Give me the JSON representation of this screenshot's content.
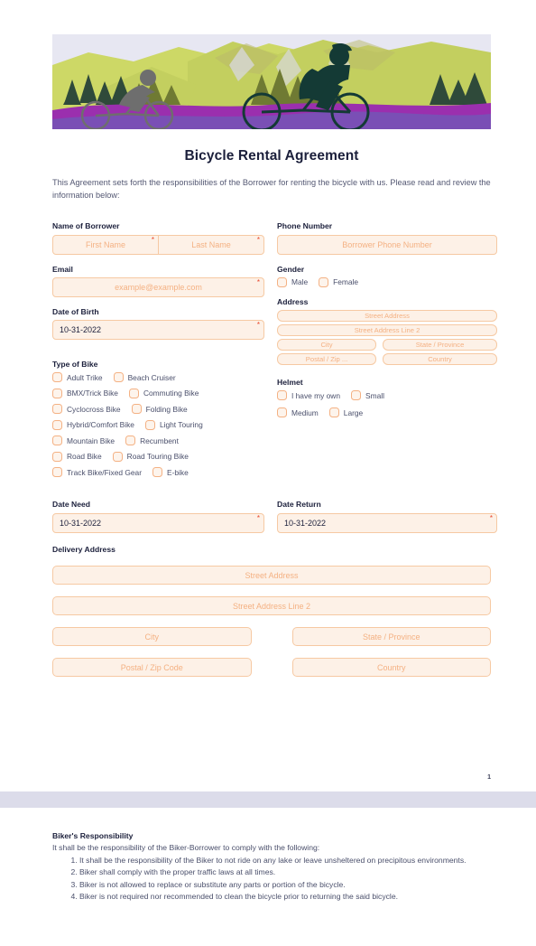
{
  "document": {
    "title": "Bicycle Rental Agreement",
    "intro": "This Agreement sets forth the responsibilities of the Borrower for renting the bicycle with us. Please read and review the information below:",
    "page_number": "1"
  },
  "banner": {
    "alt": "Cyclists riding in mountain landscape",
    "colors": {
      "sky": "#e7e7f2",
      "mountain_light": "#cdd866",
      "mountain_mid": "#c3cf5f",
      "mountain_shadow": "#b9b96a",
      "snow": "#d8d8e0",
      "trees_dark": "#2f4a3a",
      "trees_olive": "#6f7a33",
      "ground_purple": "#9b2fae",
      "ground_violet": "#7a4fb5",
      "rider_grey": "#6e6e6e",
      "rider_teal": "#143a35"
    }
  },
  "form": {
    "name": {
      "label": "Name of Borrower",
      "first_placeholder": "First Name",
      "last_placeholder": "Last Name",
      "required_mark": "*"
    },
    "email": {
      "label": "Email",
      "placeholder": "example@example.com"
    },
    "dob": {
      "label": "Date of Birth",
      "value": "10-31-2022"
    },
    "phone": {
      "label": "Phone Number",
      "placeholder": "Borrower Phone Number"
    },
    "gender": {
      "label": "Gender",
      "options": [
        "Male",
        "Female"
      ]
    },
    "address": {
      "label": "Address",
      "street": "Street Address",
      "street2": "Street Address Line 2",
      "city": "City",
      "state": "State / Province",
      "postal": "Postal / Zip ...",
      "country": "Country"
    },
    "helmet": {
      "label": "Helmet",
      "options": [
        "I have my own",
        "Small",
        "Medium",
        "Large"
      ]
    },
    "bike_type": {
      "label": "Type of Bike",
      "rows": [
        [
          "Adult Trike",
          "Beach Cruiser"
        ],
        [
          "BMX/Trick Bike",
          "Commuting Bike"
        ],
        [
          "Cyclocross Bike",
          "Folding Bike"
        ],
        [
          "Hybrid/Comfort Bike",
          "Light Touring"
        ],
        [
          "Mountain Bike",
          "Recumbent"
        ],
        [
          "Road Bike",
          "Road Touring Bike"
        ],
        [
          "Track Bike/Fixed Gear",
          "E-bike"
        ]
      ]
    },
    "date_need": {
      "label": "Date Need",
      "value": "10-31-2022"
    },
    "date_return": {
      "label": "Date Return",
      "value": "10-31-2022"
    },
    "delivery_address": {
      "label": "Delivery Address",
      "street": "Street Address",
      "street2": "Street Address Line 2",
      "city": "City",
      "state": "State / Province",
      "postal": "Postal / Zip Code",
      "country": "Country"
    }
  },
  "page2": {
    "heading": "Biker's Responsibility",
    "lead": "It shall be the responsibility of the Biker-Borrower to comply with the following:",
    "items": [
      "It shall be the responsibility of the Biker to not ride on any lake or leave unsheltered on precipitous environments.",
      "Biker shall comply with the proper traffic laws at all times.",
      "Biker is not allowed to replace or substitute any parts or portion of the bicycle.",
      "Biker is not required nor recommended to clean the bicycle prior to returning the said bicycle."
    ]
  }
}
